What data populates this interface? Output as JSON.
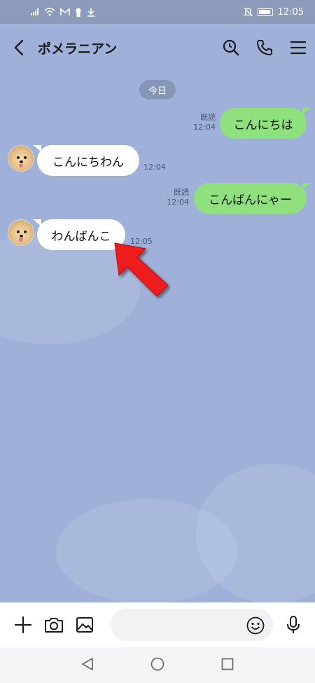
{
  "status": {
    "time": "12:05"
  },
  "chat": {
    "title": "ポメラニアン"
  },
  "date_divider": "今日",
  "messages": [
    {
      "direction": "out",
      "text": "こんにちは",
      "read": "既読",
      "time": "12:04"
    },
    {
      "direction": "in",
      "text": "こんにちわん",
      "time": "12:04"
    },
    {
      "direction": "out",
      "text": "こんばんにゃー",
      "read": "既読",
      "time": "12:04"
    },
    {
      "direction": "in",
      "text": "わんばんこ",
      "time": "12:05"
    }
  ],
  "composer": {
    "placeholder": ""
  },
  "icons": {
    "header": [
      "back-icon",
      "search-icon",
      "phone-icon",
      "menu-icon"
    ],
    "bottom": [
      "plus-icon",
      "camera-icon",
      "image-icon",
      "emoji-icon",
      "mic-icon"
    ],
    "nav": [
      "nav-back-icon",
      "nav-home-icon",
      "nav-recent-icon"
    ]
  },
  "colors": {
    "chat_bg": "#9fb1d8",
    "outgoing_bubble": "#8ee17c",
    "incoming_bubble": "#ffffff",
    "annotation_arrow": "#ee1c1c"
  }
}
